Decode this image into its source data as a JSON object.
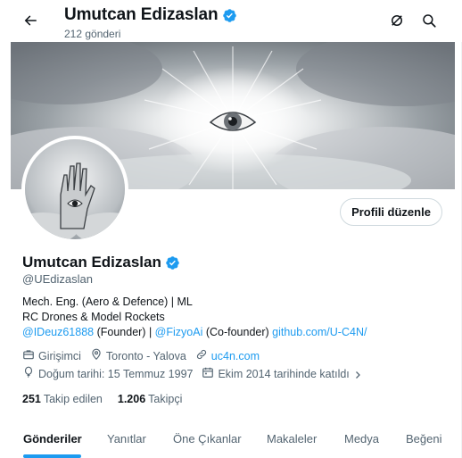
{
  "header": {
    "title": "Umutcan Edizaslan",
    "post_count": "212 gönderi"
  },
  "profile": {
    "name": "Umutcan Edizaslan",
    "handle": "@UEdizaslan",
    "edit_button": "Profili düzenle",
    "bio": {
      "line1": "Mech. Eng. (Aero & Defence) |  ML",
      "line2": "RC Drones & Model Rockets",
      "mention1": "@IDeuz61888",
      "role1": " (Founder) | ",
      "mention2": "@FizyoAi",
      "role2": " (Co-founder) ",
      "github": "github.com/U-C4N/"
    },
    "occupation": "Girişimci",
    "location": "Toronto - Yalova",
    "website": "uc4n.com",
    "birthday": "Doğum tarihi: 15 Temmuz 1997",
    "joined": "Ekim 2014 tarihinde katıldı",
    "following_count": "251",
    "following_label": "Takip edilen",
    "followers_count": "1.206",
    "followers_label": "Takipçi"
  },
  "tabs": [
    {
      "label": "Gönderiler",
      "active": true
    },
    {
      "label": "Yanıtlar",
      "active": false
    },
    {
      "label": "Öne Çıkanlar",
      "active": false
    },
    {
      "label": "Makaleler",
      "active": false
    },
    {
      "label": "Medya",
      "active": false
    },
    {
      "label": "Beğeni",
      "active": false
    }
  ],
  "colors": {
    "accent": "#1d9bf0",
    "text": "#0f1419",
    "muted": "#536471"
  },
  "icons": {
    "back": "arrow-left-icon",
    "grok": "grok-icon",
    "search": "search-icon",
    "verified": "verified-badge-icon",
    "occupation": "briefcase-icon",
    "location": "location-pin-icon",
    "website": "link-icon",
    "birthday": "balloon-icon",
    "joined": "calendar-icon",
    "chevron": "chevron-right-icon"
  }
}
